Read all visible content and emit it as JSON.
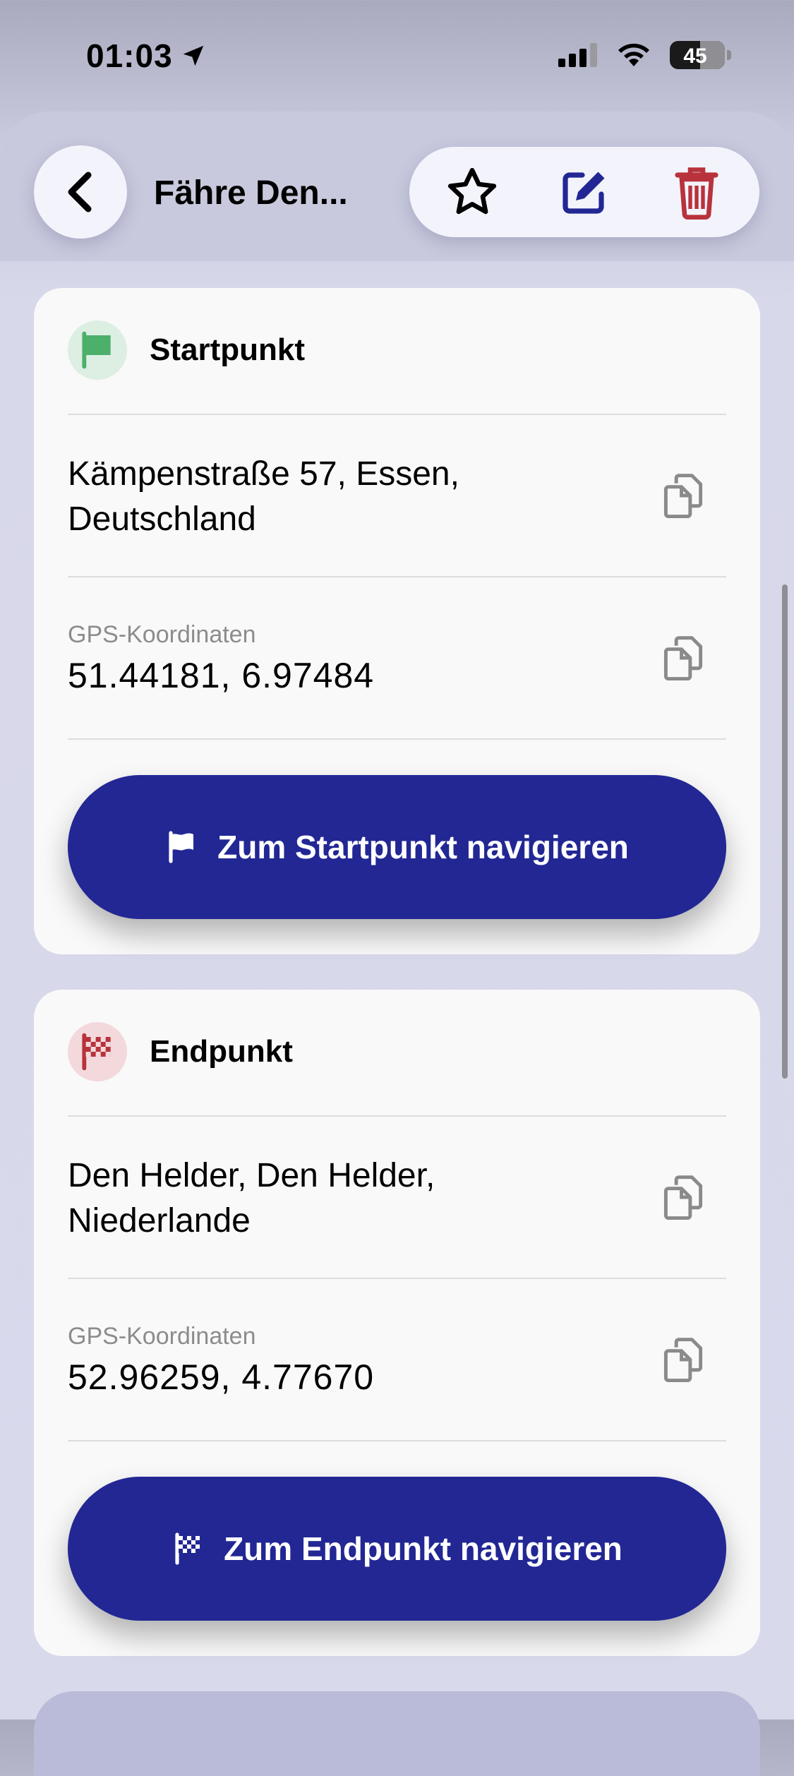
{
  "status_bar": {
    "time": "01:03",
    "battery": "45",
    "battery_level": 0.45
  },
  "header": {
    "title": "Fähre Den..."
  },
  "start": {
    "title": "Startpunkt",
    "address": "Kämpenstraße 57, Essen, Deutschland",
    "gps_label": "GPS-Koordinaten",
    "gps_value": "51.44181, 6.97484",
    "button_label": "Zum Startpunkt navigieren"
  },
  "end": {
    "title": "Endpunkt",
    "address": "Den Helder, Den Helder, Niederlande",
    "gps_label": "GPS-Koordinaten",
    "gps_value": "52.96259, 4.77670",
    "button_label": "Zum Endpunkt navigieren"
  },
  "icons": {
    "back": "chevron-left-icon",
    "favorite": "star-icon",
    "edit": "edit-icon",
    "delete": "trash-icon",
    "start_flag": "flag-icon",
    "end_flag": "checkered-flag-icon",
    "copy": "copy-icon"
  },
  "colors": {
    "accent": "#222794",
    "start_green": "#4caf6a",
    "end_red": "#b8323c",
    "delete_red": "#b8323c",
    "edit_blue": "#222794"
  }
}
